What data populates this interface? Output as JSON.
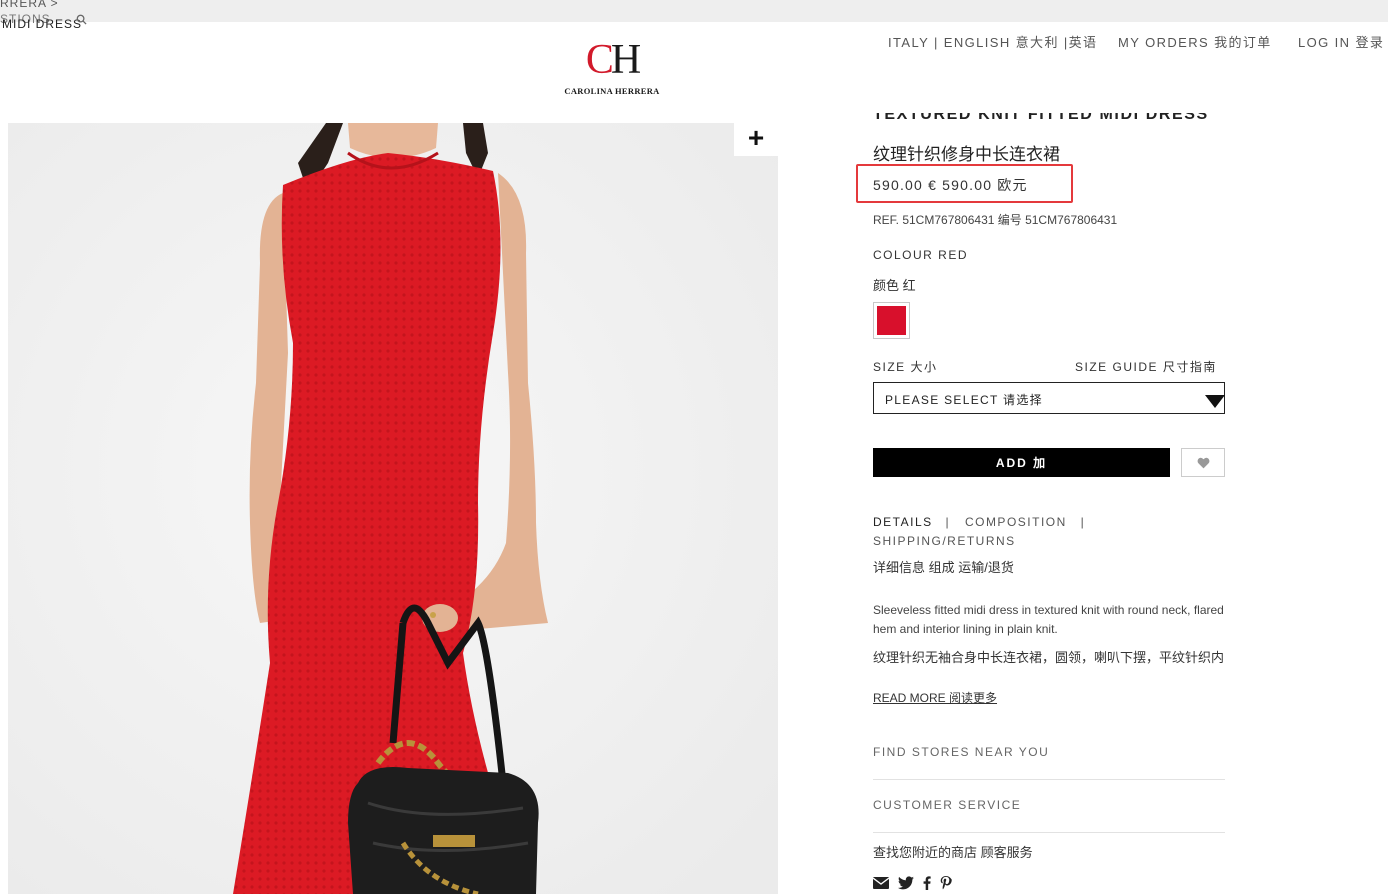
{
  "breadcrumb": {
    "line1": "RRERA  >",
    "line2": "STIONS",
    "line3": "MIDI DRESS"
  },
  "brand": {
    "initial_c": "C",
    "initial_h": "H",
    "name": "CAROLINA HERRERA",
    "accent_color": "#d21a2b"
  },
  "header": {
    "language": "ITALY | ENGLISH  意大利 |英语",
    "orders": "MY ORDERS  我的订单",
    "login": "LOG IN  登录"
  },
  "gallery": {
    "zoom_icon": "plus-icon",
    "image_description_icon": "product-photo"
  },
  "product": {
    "title_en": "TEXTURED KNIT FITTED MIDI DRESS",
    "title_zh": "纹理针织修身中长连衣裙",
    "price": "590.00 €  590.00 欧元",
    "ref": "REF. 51CM767806431  编号 51CM767806431",
    "colour_label": "COLOUR RED",
    "colour_zh": "颜色 红",
    "swatch_color": "#d8102c",
    "size_label": "SIZE  大小",
    "size_guide": "SIZE GUIDE  尺寸指南",
    "size_select_value": "PLEASE SELECT  请选择",
    "add_label": "ADD  加",
    "wishlist_icon": "heart-icon"
  },
  "details": {
    "tab_details": "DETAILS",
    "tab_composition": "COMPOSITION",
    "tab_shipping": "SHIPPING/RETURNS",
    "separator": "|",
    "tabs_zh": "详细信息 组成 运输/退货",
    "description_en": "Sleeveless fitted midi dress in textured knit with round neck, flared hem and interior lining in plain knit.",
    "description_zh": "纹理针织无袖合身中长连衣裙，圆领，喇叭下摆，平纹针织内衬",
    "read_more": "READ MORE  阅读更多"
  },
  "services": {
    "find_stores": "FIND STORES NEAR YOU",
    "customer_service": "CUSTOMER SERVICE",
    "services_zh": "查找您附近的商店 顾客服务"
  },
  "socials": [
    "mail-icon",
    "twitter-icon",
    "facebook-icon",
    "pinterest-icon"
  ]
}
